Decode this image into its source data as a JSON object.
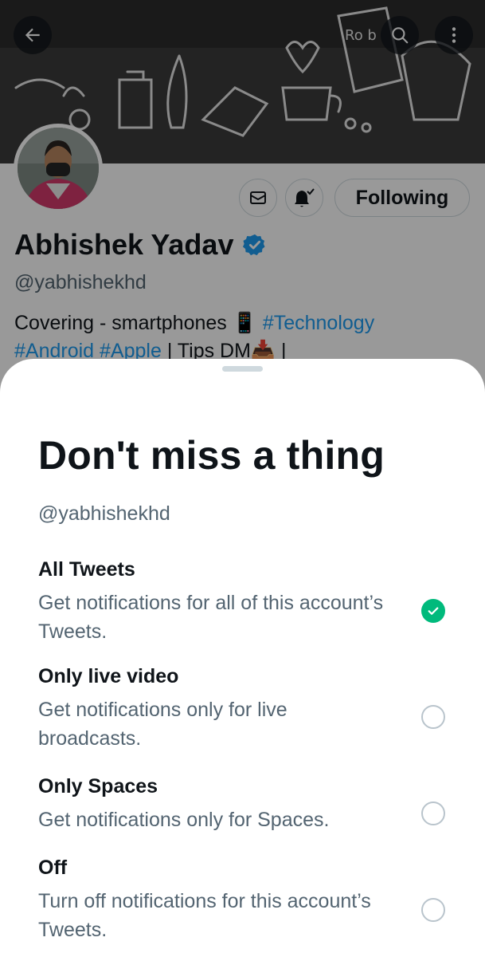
{
  "colors": {
    "accent": "#1d9bf0",
    "selected": "#00ba7c",
    "text_primary": "#0f1419",
    "text_secondary": "#536471"
  },
  "header": {
    "icons": [
      "arrow-left-icon",
      "search-icon",
      "more-vertical-icon"
    ]
  },
  "profile": {
    "name": "Abhishek Yadav",
    "handle": "@yabhishekhd",
    "following_label": "Following",
    "bio_line1_plain": "Covering - smartphones 📱 ",
    "bio_line1_tag": "#Technology",
    "bio_line2_tags": "#Android #Apple",
    "bio_line2_plain": " | Tips DM📥 |"
  },
  "sheet": {
    "title": "Don't miss a thing",
    "handle": "@yabhishekhd",
    "options": [
      {
        "title": "All Tweets",
        "description": "Get notifications for all of this account’s Tweets.",
        "selected": true
      },
      {
        "title": "Only live video",
        "description": "Get notifications only for live broadcasts.",
        "selected": false
      },
      {
        "title": "Only Spaces",
        "description": "Get notifications only for Spaces.",
        "selected": false
      },
      {
        "title": "Off",
        "description": "Turn off notifications for this account’s Tweets.",
        "selected": false
      }
    ]
  }
}
